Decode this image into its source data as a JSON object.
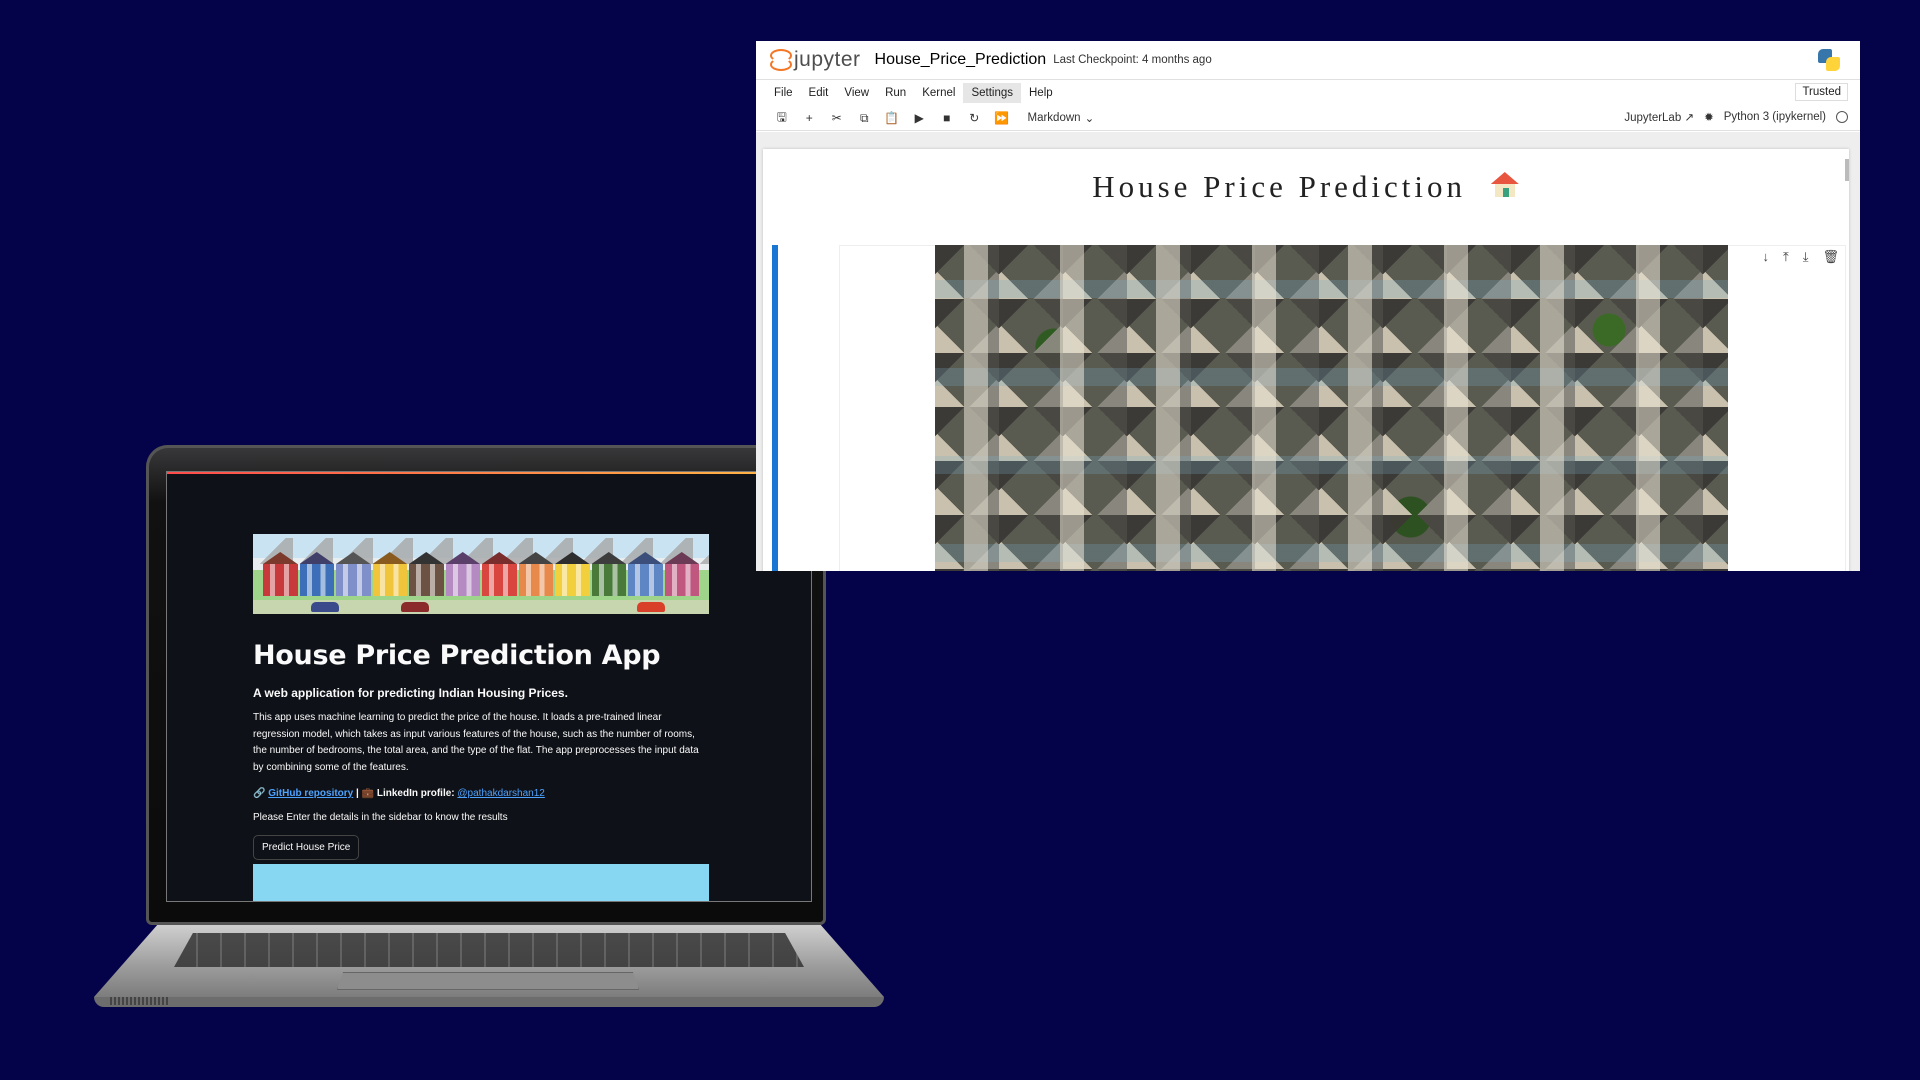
{
  "streamlit": {
    "title": "House Price Prediction App",
    "subtitle": "A web application for predicting Indian Housing Prices.",
    "description": "This app uses machine learning to predict the price of the house. It loads a pre-trained linear regression model, which takes as input various features of the house, such as the number of rooms, the number of bedrooms, the total area, and the type of the flat. The app preprocesses the input data by combining some of the features.",
    "link_icon": "🔗",
    "github_link": "GitHub repository",
    "separator": " | ",
    "briefcase_icon": "💼",
    "linkedin_label": " LinkedIn profile: ",
    "linkedin_handle": "@pathakdarshan12",
    "note": "Please Enter the details in the sidebar to know the results",
    "predict_button": "Predict House Price"
  },
  "jupyter": {
    "logo_text": "jupyter",
    "notebook_title": "House_Price_Prediction",
    "checkpoint": "Last Checkpoint: 4 months ago",
    "menu": [
      "File",
      "Edit",
      "View",
      "Run",
      "Kernel",
      "Settings",
      "Help"
    ],
    "active_menu": "Settings",
    "trusted": "Trusted",
    "cell_type": "Markdown",
    "jupyterlab_link": "JupyterLab",
    "kernel": "Python 3 (ipykernel)",
    "markdown_heading": "House Price Prediction",
    "toolbar_icons": [
      "save-icon",
      "add-cell-icon",
      "cut-icon",
      "copy-icon",
      "paste-icon",
      "run-icon",
      "stop-icon",
      "restart-icon",
      "run-all-icon"
    ],
    "cell_action_icons": [
      "move-down-icon",
      "insert-above-icon",
      "insert-below-icon",
      "delete-icon"
    ]
  },
  "colors": {
    "background": "#04034a",
    "streamlit_bg": "#0e1117",
    "link_blue": "#4ea3ff",
    "jupyter_orange": "#f37726",
    "cell_active": "#1976d2"
  }
}
